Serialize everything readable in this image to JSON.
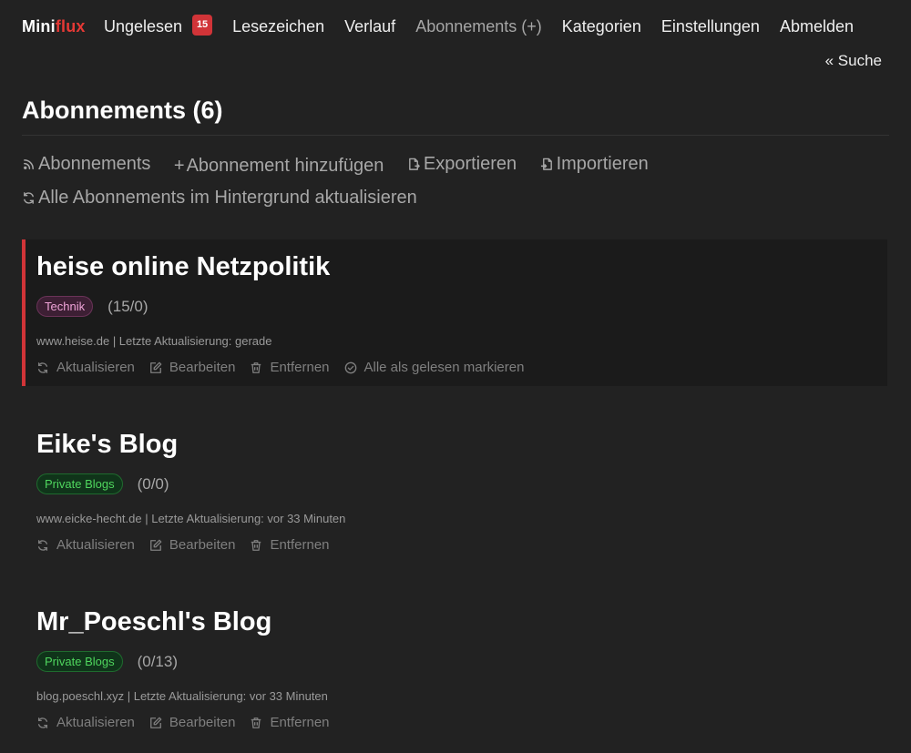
{
  "logo": {
    "part1": "Mini",
    "part2": "flux"
  },
  "nav": {
    "unread": {
      "label": "Ungelesen",
      "count": "15"
    },
    "bookmarks": "Lesezeichen",
    "history": "Verlauf",
    "feeds": "Abonnements (+)",
    "categories": "Kategorien",
    "settings": "Einstellungen",
    "logout": "Abmelden",
    "search": "« Suche"
  },
  "page_title": "Abonnements (6)",
  "actions": {
    "feeds": "Abonnements",
    "add": "Abonnement hinzufügen",
    "export": "Exportieren",
    "import": "Importieren",
    "refresh_all": "Alle Abonnements im Hintergrund aktualisieren"
  },
  "colors": {
    "accent": "#d13438",
    "background": "#222222"
  },
  "item_actions": {
    "refresh": "Aktualisieren",
    "edit": "Bearbeiten",
    "remove": "Entfernen",
    "mark_read": "Alle als gelesen markieren"
  },
  "feeds": [
    {
      "title": "heise online Netzpolitik",
      "category": "Technik",
      "counts": "(15/0)",
      "info": "www.heise.de | Letzte Aktualisierung: gerade"
    },
    {
      "title": "Eike's Blog",
      "category": "Private Blogs",
      "counts": "(0/0)",
      "info": "www.eicke-hecht.de | Letzte Aktualisierung: vor 33 Minuten"
    },
    {
      "title": "Mr_Poeschl's Blog",
      "category": "Private Blogs",
      "counts": "(0/13)",
      "info": "blog.poeschl.xyz | Letzte Aktualisierung: vor 33 Minuten"
    }
  ]
}
